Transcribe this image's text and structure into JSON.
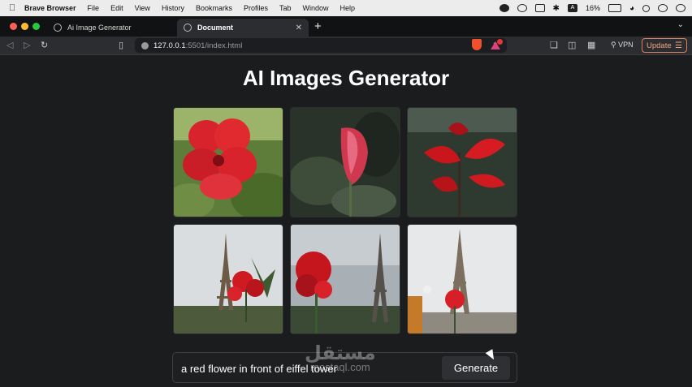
{
  "menubar": {
    "app_name": "Brave Browser",
    "items": [
      "File",
      "Edit",
      "View",
      "History",
      "Bookmarks",
      "Profiles",
      "Tab",
      "Window",
      "Help"
    ],
    "battery": "16%"
  },
  "tabs": [
    {
      "label": "Ai Image Generator",
      "active": false
    },
    {
      "label": "Document",
      "active": true
    }
  ],
  "toolbar": {
    "url_host": "127.0.0.1",
    "url_path": ":5501/index.html",
    "rewards_badge": "1",
    "vpn_label": "VPN",
    "update_label": "Update"
  },
  "page": {
    "title": "AI Images Generator",
    "images": [
      {
        "subject": "red-flower-1"
      },
      {
        "subject": "red-flower-2"
      },
      {
        "subject": "red-flower-3"
      },
      {
        "subject": "flower-eiffel-1"
      },
      {
        "subject": "flower-eiffel-2"
      },
      {
        "subject": "flower-eiffel-3"
      }
    ],
    "prompt_value": "a red flower in front of eiffel tower",
    "generate_label": "Generate"
  },
  "watermark": {
    "arabic": "مستقل",
    "latin": "mostaql.com"
  },
  "colors": {
    "accent_update": "#f0a27c",
    "brave": "#f0502b",
    "page_bg": "#1b1c1e"
  }
}
